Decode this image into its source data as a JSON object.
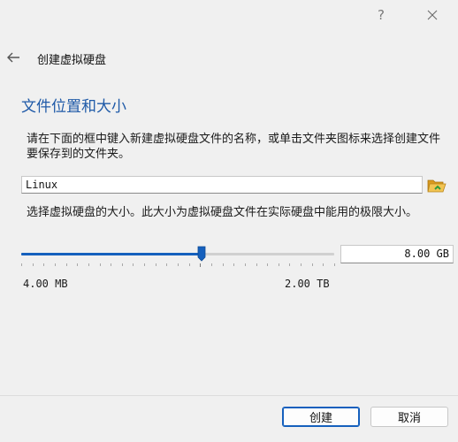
{
  "title_bar": {
    "help_label": "?"
  },
  "header": {
    "title": "创建虚拟硬盘"
  },
  "section": {
    "title": "文件位置和大小"
  },
  "location": {
    "description": "请在下面的框中键入新建虚拟硬盘文件的名称，或单击文件夹图标来选择创建文件要保存到的文件夹。",
    "file_name": "Linux",
    "folder_icon": "folder-open-icon"
  },
  "size": {
    "description": "选择虚拟硬盘的大小。此大小为虚拟硬盘文件在实际硬盘中能用的极限大小。",
    "value": "8.00 GB",
    "min_label": "4.00 MB",
    "max_label": "2.00 TB",
    "slider_fraction": 0.57
  },
  "footer": {
    "create_label": "创建",
    "cancel_label": "取消"
  },
  "colors": {
    "accent": "#1560bd",
    "section_title": "#1f5aa8",
    "folder": "#e8b33a"
  }
}
